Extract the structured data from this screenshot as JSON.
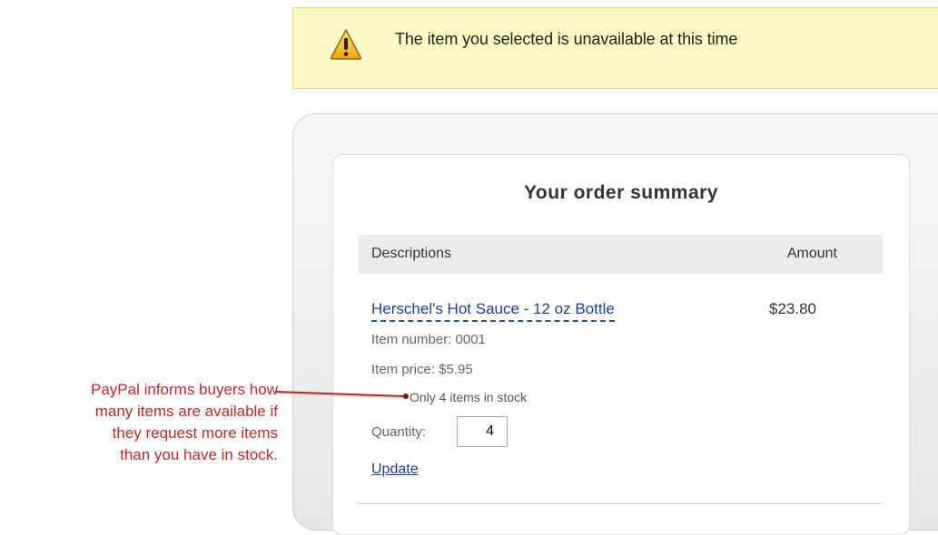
{
  "warning": {
    "message": "The item you selected is unavailable at this time",
    "icon": "warning-triangle-icon",
    "background_color": "#fcf8c4"
  },
  "order_summary": {
    "title": "Your order summary",
    "columns": {
      "description": "Descriptions",
      "amount": "Amount"
    },
    "item": {
      "name": "Herschel's Hot Sauce - 12 oz Bottle",
      "amount": "$23.80",
      "number": "Item number: 0001",
      "price": "Item price: $5.95",
      "stock_note": "Only 4 items in stock",
      "quantity_label": "Quantity:",
      "quantity_value": "4",
      "update_label": "Update"
    }
  },
  "annotation": {
    "lines": [
      "PayPal informs buyers how",
      "many items are available if",
      "they request more items",
      "than you have in stock."
    ],
    "color": "#c0282b"
  }
}
